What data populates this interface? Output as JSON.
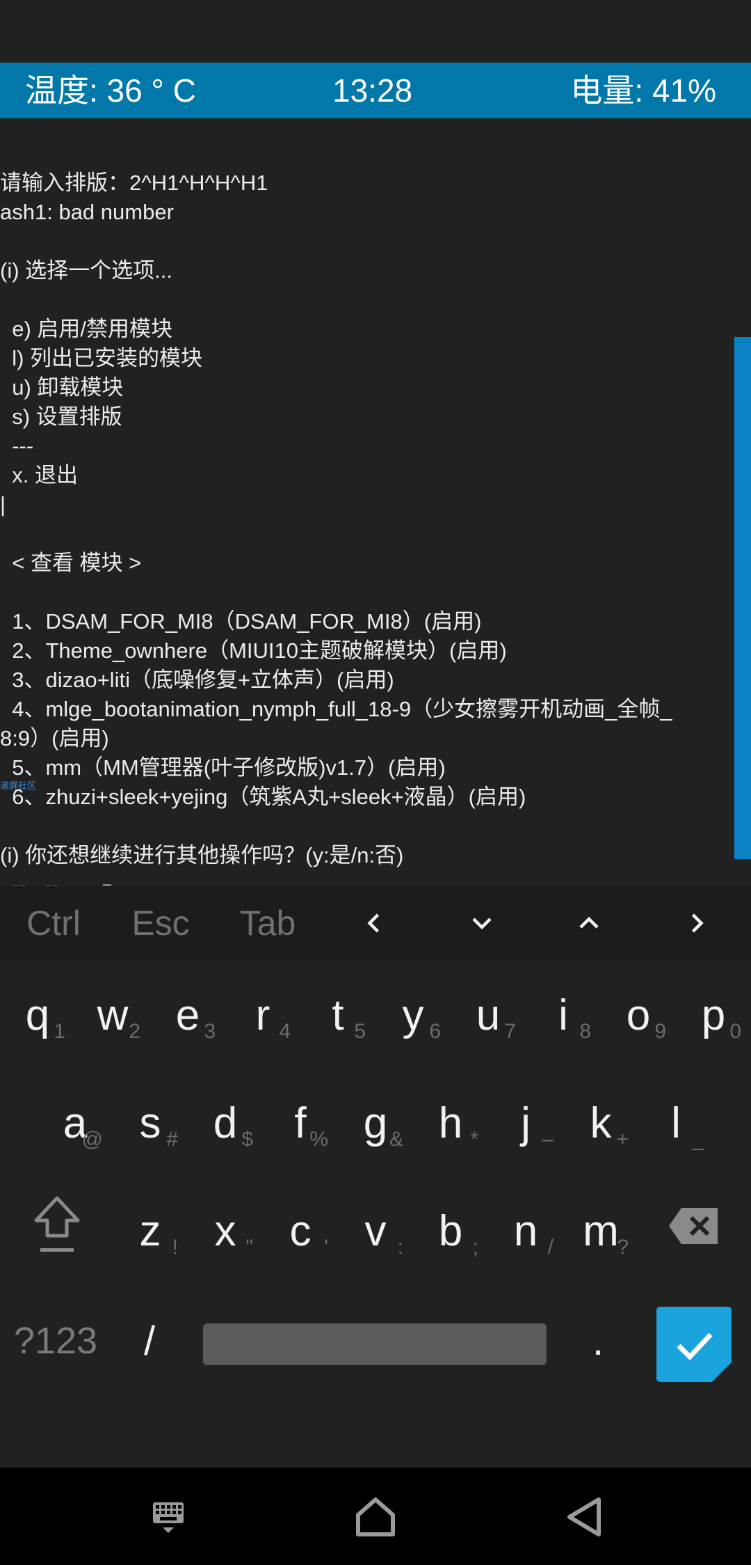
{
  "info_bar": {
    "temperature": "温度: 36 ° C",
    "time": "13:28",
    "battery": "电量: 41%"
  },
  "terminal": {
    "lines": [
      "请输入排版：2^H1^H^H^H1",
      "ash1: bad number",
      "",
      "(i) 选择一个选项...",
      "",
      "  e) 启用/禁用模块",
      "  l) 列出已安装的模块",
      "  u) 卸载模块",
      "  s) 设置排版",
      "  ---",
      "  x. 退出",
      "|",
      "",
      "  < 查看 模块 >",
      "",
      "  1、DSAM_FOR_MI8（DSAM_FOR_MI8）(启用)",
      "  2、Theme_ownhere（MIUI10主题破解模块）(启用)",
      "  3、dizao+liti（底噪修复+立体声）(启用)",
      "  4、mlge_bootanimation_nymph_full_18-9（少女擦雾开机动画_全帧_",
      "8:9）(启用)",
      "  5、mm（MM管理器(叶子修改版)v1.7）(启用)",
      "  6、zhuzi+sleek+yejing（筑紫A丸+sleek+液晶）(启用)",
      "",
      "(i) 你还想继续进行其他操作吗？(y:是/n:否)"
    ],
    "watermark": "滚屏社区"
  },
  "extra_keys": {
    "ctrl": "Ctrl",
    "esc": "Esc",
    "tab": "Tab"
  },
  "keyboard": {
    "row1": [
      {
        "key": "q",
        "alt": "1"
      },
      {
        "key": "w",
        "alt": "2"
      },
      {
        "key": "e",
        "alt": "3"
      },
      {
        "key": "r",
        "alt": "4"
      },
      {
        "key": "t",
        "alt": "5"
      },
      {
        "key": "y",
        "alt": "6"
      },
      {
        "key": "u",
        "alt": "7"
      },
      {
        "key": "i",
        "alt": "8"
      },
      {
        "key": "o",
        "alt": "9"
      },
      {
        "key": "p",
        "alt": "0"
      }
    ],
    "row2": [
      {
        "key": "a",
        "alt": "@"
      },
      {
        "key": "s",
        "alt": "#"
      },
      {
        "key": "d",
        "alt": "$"
      },
      {
        "key": "f",
        "alt": "%"
      },
      {
        "key": "g",
        "alt": "&"
      },
      {
        "key": "h",
        "alt": "*"
      },
      {
        "key": "j",
        "alt": "–"
      },
      {
        "key": "k",
        "alt": "+"
      },
      {
        "key": "l",
        "alt": "_"
      }
    ],
    "row3": [
      {
        "key": "z",
        "alt": "!"
      },
      {
        "key": "x",
        "alt": "\""
      },
      {
        "key": "c",
        "alt": "'"
      },
      {
        "key": "v",
        "alt": ":"
      },
      {
        "key": "b",
        "alt": ";"
      },
      {
        "key": "n",
        "alt": "/"
      },
      {
        "key": "m",
        "alt": "?"
      }
    ],
    "symbols_key": "?123",
    "slash_key": "/",
    "period_key": "."
  },
  "colors": {
    "info_bar": "#0277a9",
    "accent": "#0b82c6",
    "background": "#212121"
  },
  "icons": {
    "extra_keys": [
      "chevron-left-icon",
      "chevron-down-icon",
      "chevron-up-icon",
      "chevron-right-icon"
    ],
    "keyboard": [
      "shift-icon",
      "backspace-icon",
      "enter-check-icon"
    ],
    "navbar": [
      "keyboard-icon",
      "home-icon",
      "back-icon"
    ]
  }
}
